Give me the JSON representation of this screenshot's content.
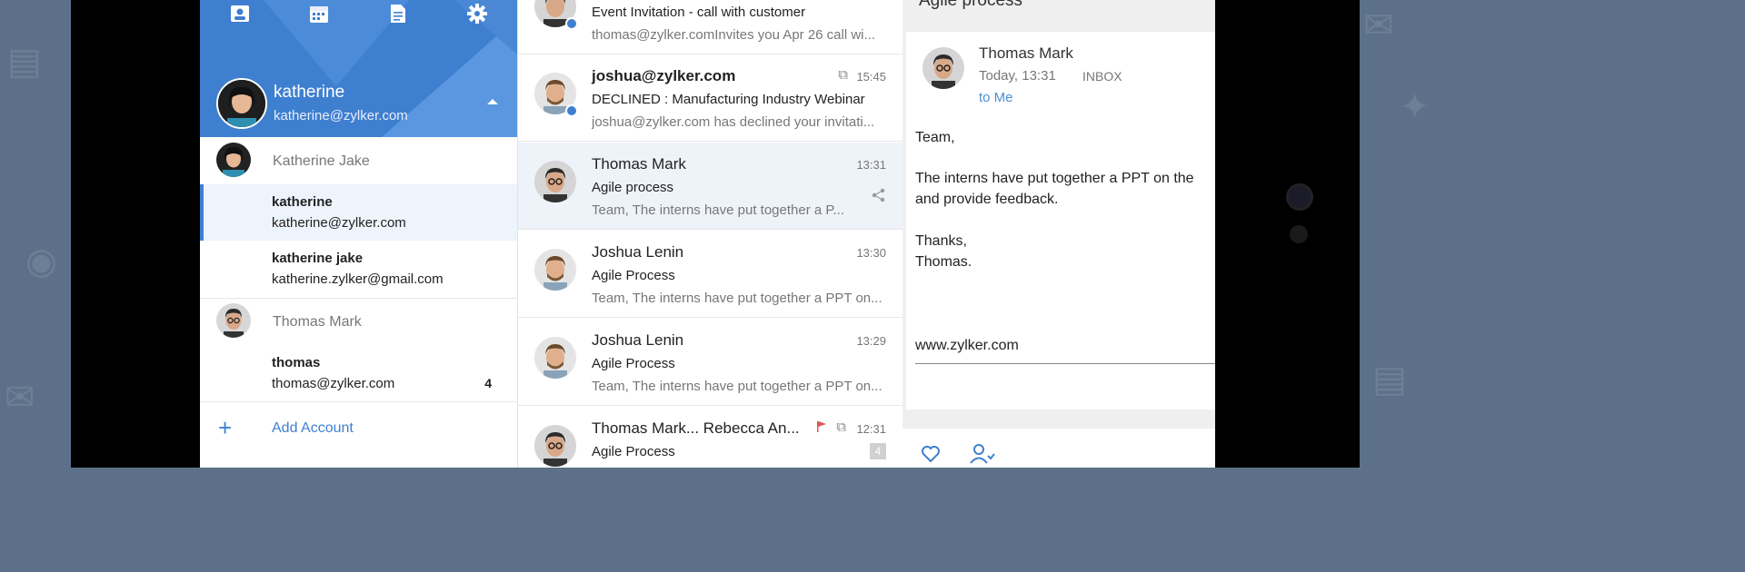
{
  "sidebar": {
    "header_icons": [
      "contacts-icon",
      "calendar-icon",
      "notes-icon",
      "settings-icon"
    ],
    "current_account": {
      "name": "katherine",
      "email": "katherine@zylker.com"
    },
    "groups": [
      {
        "title": "Katherine Jake",
        "accounts": [
          {
            "name": "katherine",
            "email": "katherine@zylker.com",
            "count": ""
          },
          {
            "name": "katherine jake",
            "email": "katherine.zylker@gmail.com",
            "count": ""
          }
        ]
      },
      {
        "title": "Thomas Mark",
        "accounts": [
          {
            "name": "thomas",
            "email": "thomas@zylker.com",
            "count": "4"
          }
        ]
      }
    ],
    "add_account": "Add Account"
  },
  "mail_list": [
    {
      "from": "",
      "time": "",
      "subject": "Event Invitation - call with customer",
      "preview": "thomas@zylker.comInvites you Apr 26 call wi..."
    },
    {
      "from": "joshua@zylker.com",
      "time": "15:45",
      "subject": "DECLINED : Manufacturing Industry Webinar",
      "preview": "joshua@zylker.com has declined your invitati..."
    },
    {
      "from": "Thomas Mark",
      "time": "13:31",
      "subject": "Agile process",
      "preview": "Team, The interns have put together a P..."
    },
    {
      "from": "Joshua Lenin",
      "time": "13:30",
      "subject": "Agile Process",
      "preview": "Team, The interns have put together a PPT on..."
    },
    {
      "from": "Joshua Lenin",
      "time": "13:29",
      "subject": "Agile Process",
      "preview": "Team, The interns have put together a PPT on..."
    },
    {
      "from": "Thomas Mark... Rebecca An...",
      "time": "12:31",
      "subject": "Agile Process",
      "badge": "4"
    }
  ],
  "reading_pane": {
    "title": "Agile process",
    "sender": "Thomas Mark",
    "date": "Today, 13:31",
    "folder": "INBOX",
    "to": "to Me",
    "body": [
      "Team,",
      "The interns have put together a PPT on the",
      "and provide feedback.",
      "Thanks,",
      "Thomas.",
      "www.zylker.com"
    ]
  },
  "colors": {
    "accent": "#3f7fd0",
    "link": "#4a8fd4",
    "background": "#5c7189"
  }
}
